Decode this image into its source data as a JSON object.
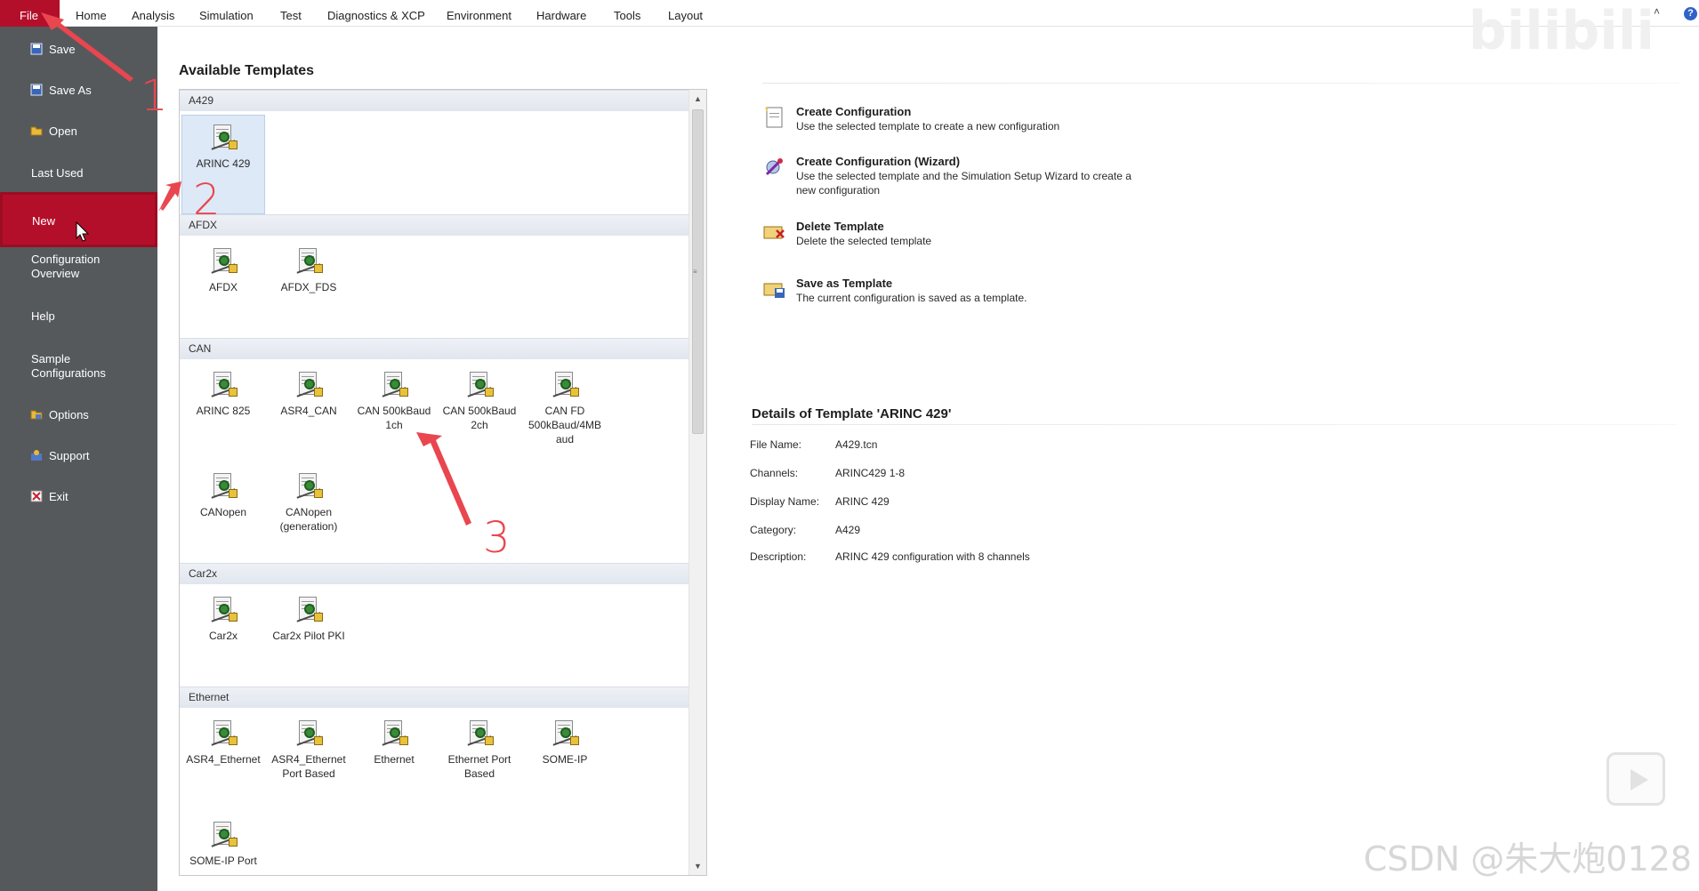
{
  "menubar": {
    "items": [
      "File",
      "Home",
      "Analysis",
      "Simulation",
      "Test",
      "Diagnostics & XCP",
      "Environment",
      "Hardware",
      "Tools",
      "Layout"
    ],
    "collapse_glyph": "˄",
    "help_glyph": "?"
  },
  "sidebar": {
    "save": "Save",
    "save_as": "Save As",
    "open": "Open",
    "last_used": "Last Used",
    "new": "New",
    "config_overview_1": "Configuration",
    "config_overview_2": "Overview",
    "help": "Help",
    "sample_1": "Sample",
    "sample_2": "Configurations",
    "options": "Options",
    "support": "Support",
    "exit": "Exit"
  },
  "templates": {
    "title": "Available Templates",
    "groups": [
      {
        "name": "A429",
        "items": [
          {
            "label": "ARINC 429",
            "selected": true
          }
        ]
      },
      {
        "name": "AFDX",
        "items": [
          {
            "label": "AFDX"
          },
          {
            "label": "AFDX_FDS"
          }
        ]
      },
      {
        "name": "CAN",
        "items": [
          {
            "label": "ARINC 825"
          },
          {
            "label": "ASR4_CAN"
          },
          {
            "label": "CAN 500kBaud 1ch"
          },
          {
            "label": "CAN 500kBaud 2ch"
          },
          {
            "label": "CAN FD 500kBaud/4MB aud"
          },
          {
            "label": "CANopen"
          },
          {
            "label": "CANopen (generation)"
          }
        ]
      },
      {
        "name": "Car2x",
        "items": [
          {
            "label": "Car2x"
          },
          {
            "label": "Car2x Pilot PKI"
          }
        ]
      },
      {
        "name": "Ethernet",
        "items": [
          {
            "label": "ASR4_Ethernet"
          },
          {
            "label": "ASR4_Ethernet Port Based"
          },
          {
            "label": "Ethernet"
          },
          {
            "label": "Ethernet Port Based"
          },
          {
            "label": "SOME-IP"
          },
          {
            "label": "SOME-IP Port"
          }
        ]
      }
    ],
    "scroll_grip": "≡",
    "scroll_up": "▲",
    "scroll_down": "▼"
  },
  "actions": [
    {
      "title": "Create Configuration",
      "desc": "Use the selected template to create a new configuration",
      "icon": "new-config-icon"
    },
    {
      "title": "Create Configuration (Wizard)",
      "desc": "Use the selected template and the Simulation Setup Wizard to create a new configuration",
      "icon": "wizard-icon"
    },
    {
      "title": "Delete Template",
      "desc": "Delete the selected template",
      "icon": "delete-template-icon"
    },
    {
      "title": "Save as Template",
      "desc": "The current configuration is saved as a template.",
      "icon": "save-template-icon"
    }
  ],
  "details": {
    "title": "Details of Template 'ARINC 429'",
    "rows": [
      {
        "label": "File Name:",
        "value": "A429.tcn"
      },
      {
        "label": "Channels:",
        "value": "ARINC429 1-8"
      },
      {
        "label": "Display Name:",
        "value": "ARINC 429"
      },
      {
        "label": "Category:",
        "value": "A429"
      },
      {
        "label": "Description:",
        "value": "ARINC 429 configuration with 8 channels"
      }
    ]
  },
  "annotations": {
    "n1": "1",
    "n2": "2",
    "n3": "3"
  },
  "watermarks": {
    "csdn": "CSDN @朱大炮0128",
    "bili": "bilibili"
  },
  "colors": {
    "accent": "#b40f2a",
    "sidebar": "#56595c",
    "annotation": "#e9464f"
  }
}
